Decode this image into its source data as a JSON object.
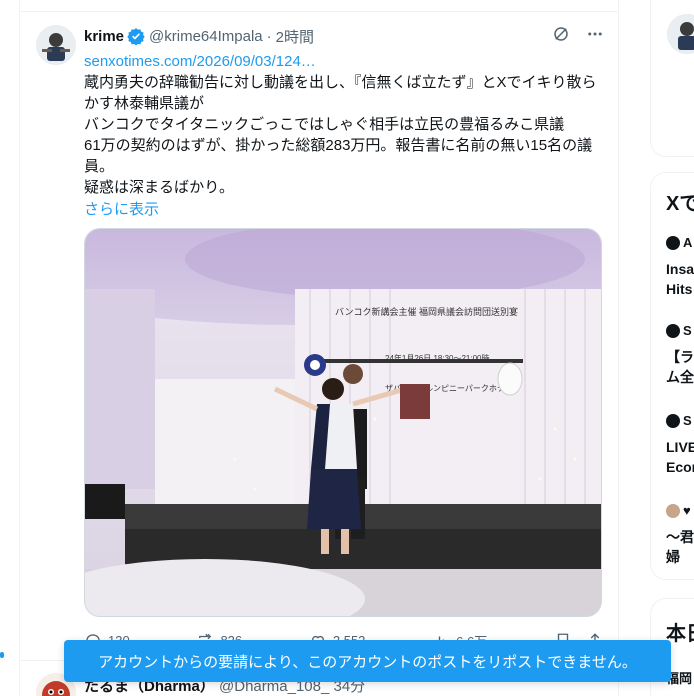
{
  "post": {
    "display_name": "krime",
    "handle": "@krime64Impala",
    "separator": "·",
    "time": "2時間",
    "link": "senxotimes.com/2026/09/03/124…",
    "lines": [
      "蔵内勇夫の辞職勧告に対し動議を出し、『信無くば立たず』とXでイキり散らかす林泰輔県議が",
      "バンコクでタイタニックごっこではしゃぐ相手は立民の豊福るみこ県議",
      "61万の契約のはずが、掛かった総額283万円。報告書に名前の無い15名の議員。",
      "疑惑は深まるばかり。"
    ],
    "show_more": "さらに表示",
    "actions": {
      "reply_count": "130",
      "repost_count": "826",
      "like_count": "2,552",
      "view_count": "6.6万"
    },
    "banner_text": [
      "バンコク新講会主催 福岡県議会訪問団送別宴",
      "24年1月26日 18:30～21:00時",
      "ザバンコクルンピニーパークホテル"
    ]
  },
  "next_post": {
    "display_name": "たるま（Dharma）",
    "handle": "@Dharma_108_",
    "time": "34分"
  },
  "toast": {
    "message": "アカウントからの要請により、このアカウントのポストをリポストできません。"
  },
  "sidebar": {
    "trends_title": "Xで",
    "items": [
      {
        "label": "A",
        "text_lines": [
          "Insa",
          "Hits"
        ]
      },
      {
        "label": "S",
        "text_lines": [
          "【ラ",
          "ム全"
        ]
      },
      {
        "label": "S",
        "text_lines": [
          "LIVE",
          "Econ"
        ]
      },
      {
        "label": "♥",
        "text_lines": [
          "〜君",
          "婦"
        ]
      }
    ],
    "section2_title": "本日",
    "section2_item": "福岡"
  },
  "colors": {
    "accent": "#1d9bf0",
    "text": "#0f1419",
    "secondary": "#536471",
    "border": "#eff3f4"
  }
}
